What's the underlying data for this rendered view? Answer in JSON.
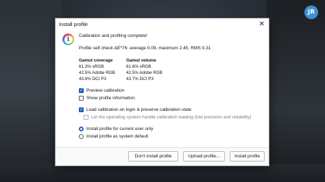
{
  "badge": {
    "text": "JR"
  },
  "dialog": {
    "title": "Install profile",
    "close_glyph": "✕",
    "icon_glyph": "i",
    "headline": "Calibration and profiling complete!",
    "self_check": "Profile self check ΔE*76: average 0.09, maximum 2.45, RMS 0.31",
    "coverage": {
      "header": "Gamut coverage",
      "lines": [
        "61.3% sRGB",
        "42.5% Adobe RGB",
        "43.6% DCI P3"
      ]
    },
    "volume": {
      "header": "Gamut volume",
      "lines": [
        "61.6% sRGB",
        "42.5% Adobe RGB",
        "43.7% DCI P3"
      ]
    },
    "options": {
      "preview_calibration": {
        "label": "Preview calibration",
        "checked": true
      },
      "show_profile_info": {
        "label": "Show profile information",
        "checked": false
      },
      "load_calibration": {
        "label": "Load calibration on login & preserve calibration state",
        "checked": true
      },
      "os_handle": {
        "label": "Let the operating system handle calibration loading (low precision and reliability)",
        "checked": false,
        "enabled": false
      }
    },
    "install_scope": {
      "current_user": {
        "label": "Install profile for current user only",
        "selected": true
      },
      "system_default": {
        "label": "Install profile as system default",
        "selected": false
      }
    },
    "buttons": {
      "dont_install": "Don't install profile",
      "upload": "Upload profile...",
      "install": "Install profile"
    }
  },
  "check_glyph": "✓"
}
